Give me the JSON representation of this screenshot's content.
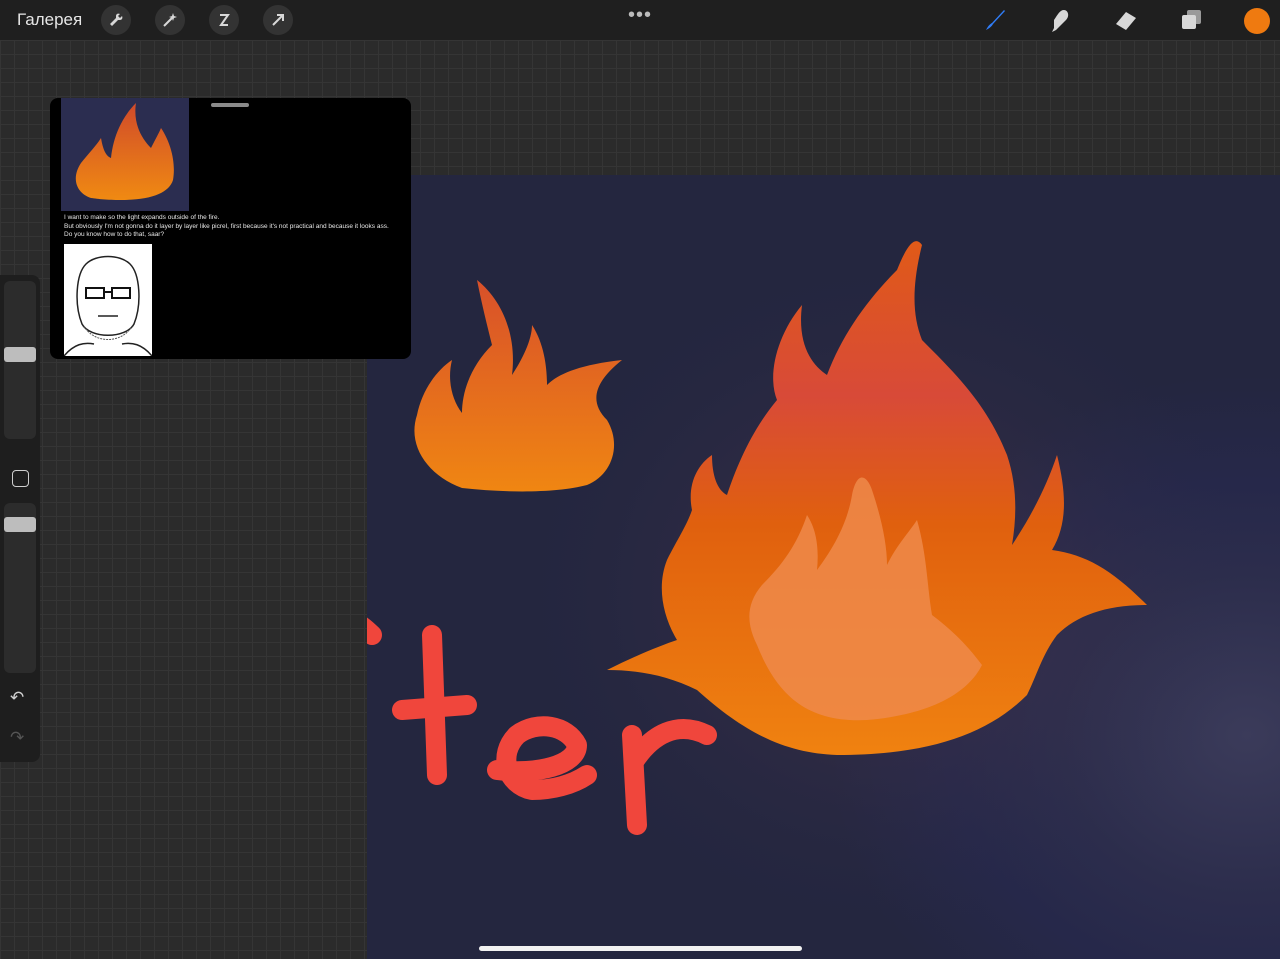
{
  "topbar": {
    "gallery_label": "Галерея",
    "left_tools": [
      "wrench-icon",
      "magic-wand-icon",
      "selection-icon",
      "transform-arrow-icon"
    ],
    "more_dots": "•••",
    "right_tools": [
      "brush-icon",
      "smudge-icon",
      "eraser-icon",
      "layers-icon"
    ],
    "active_tool": "brush-icon",
    "accent_color": "#2f7cf6",
    "current_color": "#ef7a10"
  },
  "sidebar": {
    "undo_label": "↶",
    "redo_label": "↷"
  },
  "reference_window": {
    "post_lines": [
      "I want to make so the light expands outside of the fire.",
      "But obviously I'm not gonna do it layer by layer like picrel, first because it's not practical and because it looks ass.",
      "Do you know how to do that, saar?"
    ]
  },
  "canvas": {
    "handwriting": "after",
    "handwriting_color": "#f0463c",
    "background_color": "#2c2d4c",
    "fire_colors": [
      "#ef7a10",
      "#e05a12",
      "#f08a3a"
    ]
  }
}
